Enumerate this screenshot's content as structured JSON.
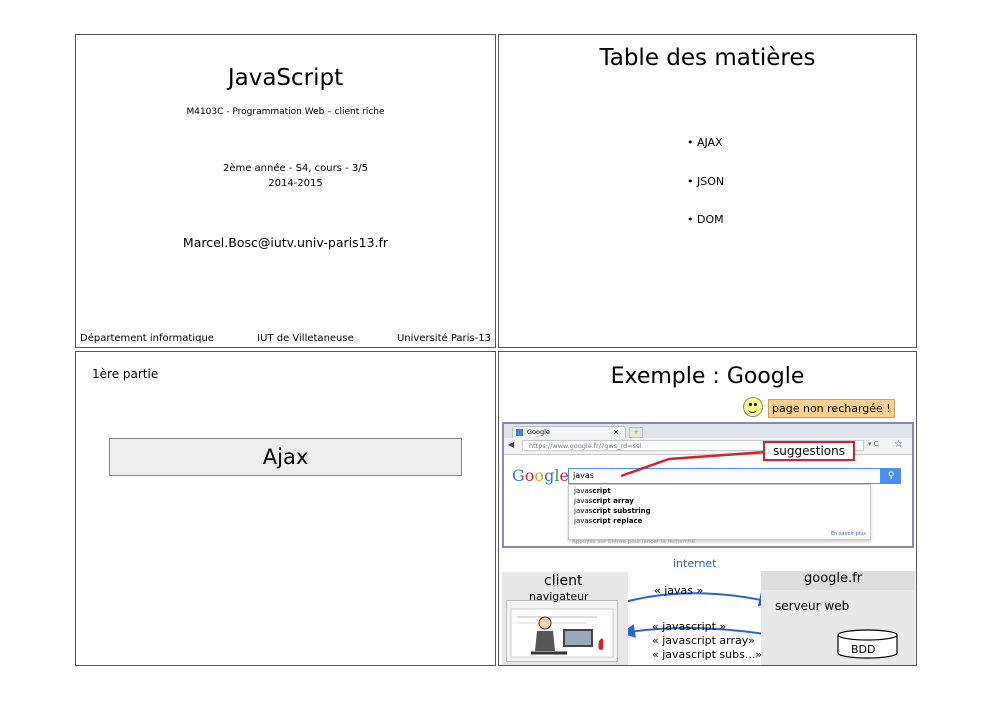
{
  "slide1": {
    "title": "JavaScript",
    "subtitle": "M4103C - Programmation Web – client riche",
    "year": "2ème année - S4, cours - 3/5",
    "dates": "2014-2015",
    "email": "Marcel.Bosc@iutv.univ-paris13.fr",
    "footer_left": "Département informatique",
    "footer_center": "IUT de Villetaneuse",
    "footer_right": "Université Paris-13"
  },
  "slide2": {
    "title": "Table des matières",
    "items": [
      "• AJAX",
      "• JSON",
      "• DOM"
    ]
  },
  "slide3": {
    "part": "1ère partie",
    "heading": "Ajax"
  },
  "slide4": {
    "title": "Exemple : Google",
    "reload_note": "page non rechargée !",
    "browser": {
      "tab_label": "Google",
      "tab_close": "×",
      "url": "https://www.google.fr/?gws_rd=ssl",
      "logo": "Google",
      "query": "javas",
      "suggestions": [
        {
          "prefix": "javas",
          "rest": "cript"
        },
        {
          "prefix": "javas",
          "rest": "cript array"
        },
        {
          "prefix": "javas",
          "rest": "cript substring"
        },
        {
          "prefix": "javas",
          "rest": "cript replace"
        }
      ],
      "more_link": "En savoir plus",
      "hint": "Appuyez sur Entrée pour lancer la recherche."
    },
    "suggestions_label": "suggestions",
    "diagram": {
      "internet": "internet",
      "client": "client",
      "navigator": "navigateur",
      "server": "google.fr",
      "server_web": "serveur web",
      "request": "« javas »",
      "responses": [
        "« javascript »",
        "« javascript array»",
        "« javascript subs...»"
      ],
      "db": "BDD"
    },
    "colors": {
      "accent_red": "#d4212a",
      "arrow_blue": "#2a62d7",
      "note_bg": "#fbd08c"
    }
  }
}
